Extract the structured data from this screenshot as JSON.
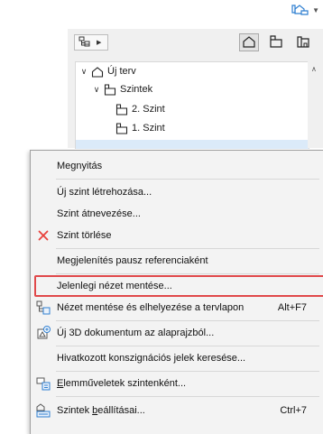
{
  "topbar": {
    "layout_button_icon": "layout-book-icon"
  },
  "navigator": {
    "toolbar": {
      "left_button_icon": "project-map-icon",
      "view_buttons": [
        {
          "name": "project-map-view",
          "selected": true
        },
        {
          "name": "view-map-view",
          "selected": false
        },
        {
          "name": "layout-book-view",
          "selected": false
        }
      ]
    },
    "tree": [
      {
        "label": "Új terv",
        "icon": "house-icon",
        "expanded": true,
        "level": 0
      },
      {
        "label": "Szintek",
        "icon": "stories-folder-icon",
        "expanded": true,
        "level": 1
      },
      {
        "label": "2. Szint",
        "icon": "story-icon",
        "level": 2
      },
      {
        "label": "1. Szint",
        "icon": "story-icon",
        "level": 2
      }
    ]
  },
  "context_menu": {
    "items": [
      {
        "id": "open",
        "label": "Megnyitás"
      },
      {
        "id": "new-story",
        "label": "Új szint létrehozása..."
      },
      {
        "id": "rename-story",
        "label": "Szint átnevezése..."
      },
      {
        "id": "delete-story",
        "label": "Szint törlése",
        "icon": "delete-x-icon",
        "icon_color": "#e8413b"
      },
      {
        "id": "show-as-trace",
        "label": "Megjelenítés pausz referenciaként"
      },
      {
        "id": "save-current-view",
        "label": "Jelenlegi nézet mentése...",
        "highlighted": true,
        "highlight_color": "#e0484a"
      },
      {
        "id": "save-and-place-view",
        "label": "Nézet mentése és elhelyezése a tervlapon",
        "shortcut": "Alt+F7",
        "icon": "save-place-view-icon"
      },
      {
        "id": "new-3d-document",
        "label": "Új 3D dokumentum az alaprajzból...",
        "icon": "new-3d-document-icon"
      },
      {
        "id": "find-markers",
        "label": "Hivatkozott konszignációs jelek keresése..."
      },
      {
        "id": "element-ops-by-story",
        "label_underlined": "E",
        "label_rest": "lemműveletek szintenként...",
        "icon": "element-operations-icon"
      },
      {
        "id": "story-settings",
        "label_start": "Szintek ",
        "label_underlined": "b",
        "label_end": "eállításai...",
        "shortcut": "Ctrl+7",
        "icon": "story-settings-icon"
      }
    ]
  }
}
